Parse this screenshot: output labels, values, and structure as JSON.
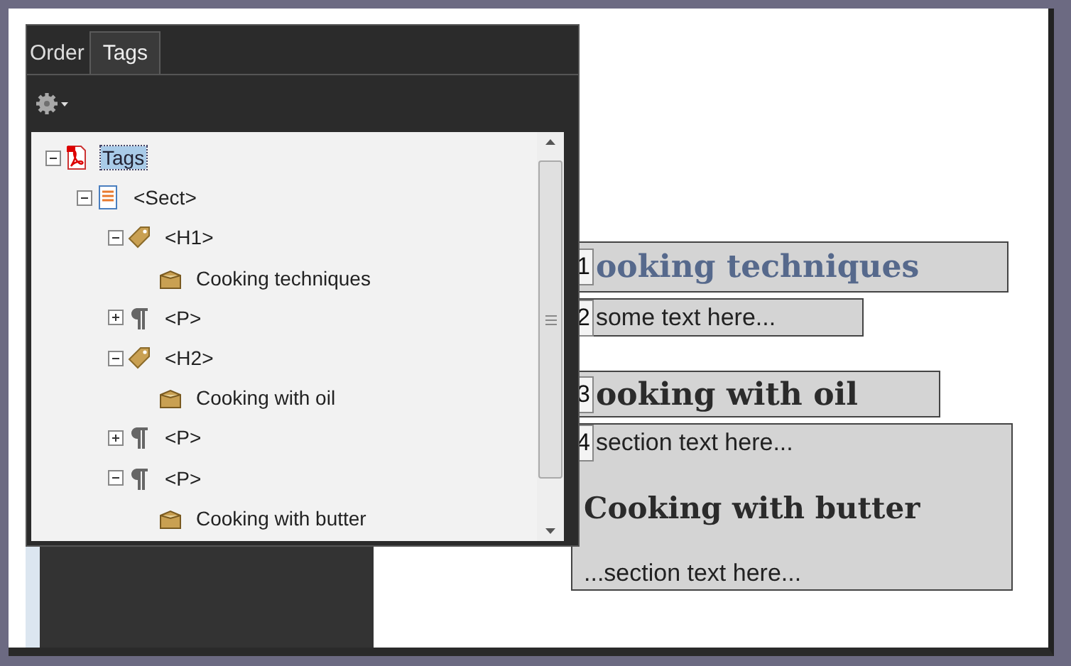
{
  "panel": {
    "tabs": [
      {
        "label": "Order",
        "selected": false
      },
      {
        "label": "Tags",
        "selected": true
      }
    ],
    "tree": [
      {
        "label": "Tags",
        "kind": "root",
        "expanded": true,
        "selected": true,
        "children": [
          {
            "label": "<Sect>",
            "kind": "sect",
            "expanded": true,
            "selected": false,
            "children": [
              {
                "label": "<H1>",
                "kind": "heading",
                "expanded": true,
                "selected": false,
                "children": [
                  {
                    "label": "Cooking techniques",
                    "kind": "content",
                    "selected": false
                  }
                ]
              },
              {
                "label": "<P>",
                "kind": "paragraph",
                "expanded": false,
                "selected": false
              },
              {
                "label": "<H2>",
                "kind": "heading",
                "expanded": true,
                "selected": false,
                "children": [
                  {
                    "label": "Cooking with oil",
                    "kind": "content",
                    "selected": false
                  }
                ]
              },
              {
                "label": "<P>",
                "kind": "paragraph",
                "expanded": false,
                "selected": false
              },
              {
                "label": "<P>",
                "kind": "paragraph",
                "expanded": true,
                "selected": false,
                "children": [
                  {
                    "label": "Cooking with butter",
                    "kind": "content",
                    "selected": false
                  }
                ]
              }
            ]
          }
        ]
      }
    ]
  },
  "document": {
    "blocks": [
      {
        "number": "1",
        "kind": "heading1",
        "texts": [
          "ooking techniques"
        ]
      },
      {
        "number": "2",
        "kind": "paragraph",
        "texts": [
          "some text here..."
        ]
      },
      {
        "number": "3",
        "kind": "heading2",
        "texts": [
          "ooking with oil"
        ]
      },
      {
        "number": "4",
        "kind": "section",
        "texts": [
          "section text here...",
          "Cooking with butter",
          "...section text here..."
        ]
      }
    ]
  }
}
